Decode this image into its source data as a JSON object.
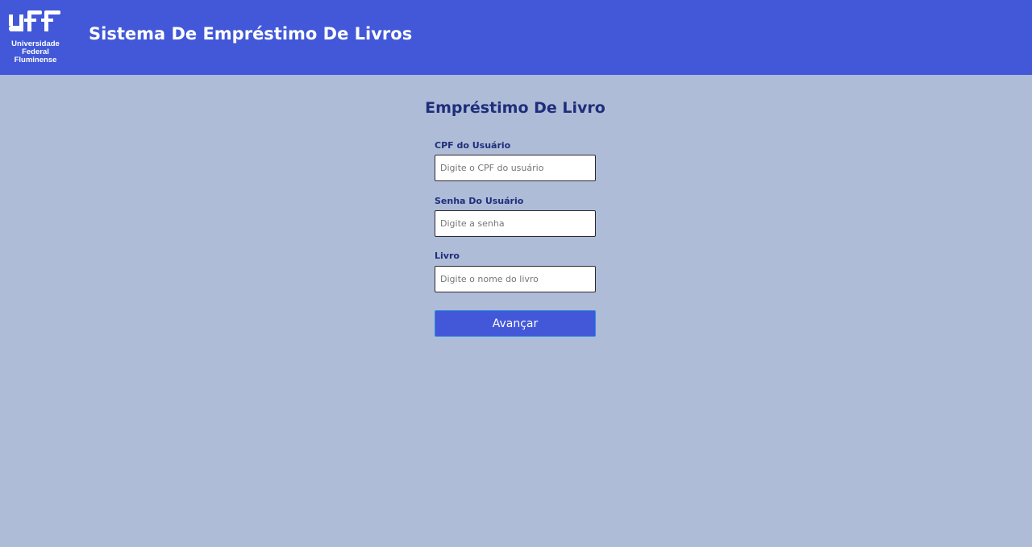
{
  "header": {
    "logo_text": "uff",
    "logo_lines": [
      "Universidade",
      "Federal",
      "Fluminense"
    ],
    "title": "Sistema De Empréstimo De Livros"
  },
  "form": {
    "title": "Empréstimo De Livro",
    "cpf": {
      "label": "CPF do Usuário",
      "placeholder": "Digite o CPF do usuário",
      "value": ""
    },
    "senha": {
      "label": "Senha Do Usuário",
      "placeholder": "Digite a senha",
      "value": ""
    },
    "livro": {
      "label": "Livro",
      "placeholder": "Digite o nome do livro",
      "value": ""
    },
    "submit_label": "Avançar"
  },
  "colors": {
    "header_bg": "#4258d8",
    "page_bg": "#aebcd8",
    "title_text": "#1f2e7a",
    "button_bg": "#4258d8"
  }
}
